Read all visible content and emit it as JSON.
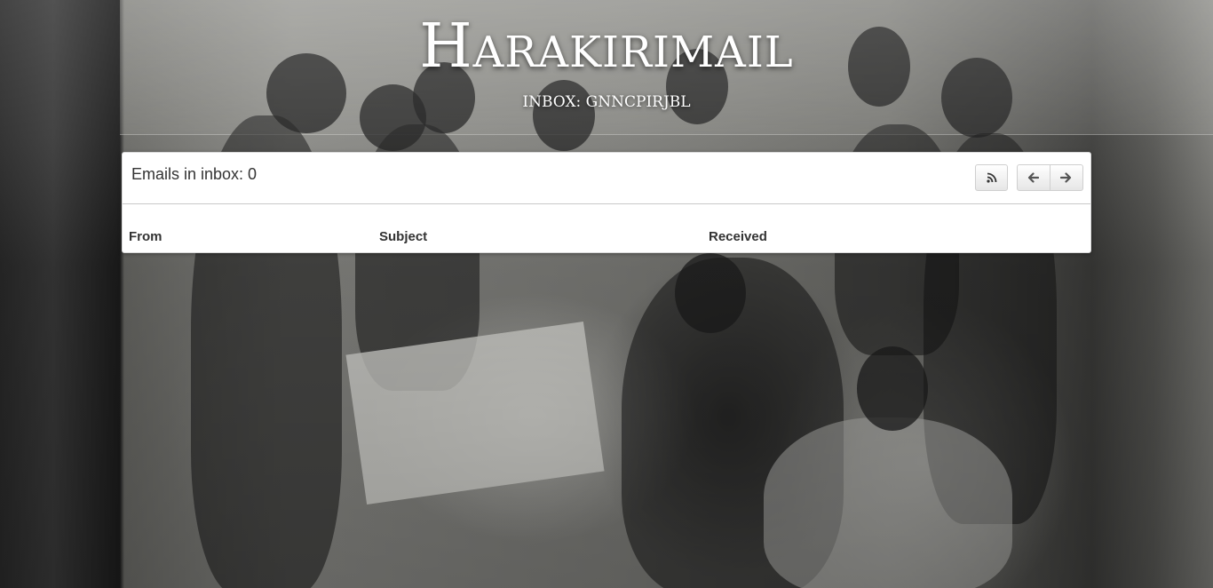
{
  "header": {
    "title": "Harakirimail",
    "inbox_label": "INBOX: GNNCPIRJBL"
  },
  "inbox": {
    "count_text": "Emails in inbox: 0",
    "buttons": {
      "rss_icon": "rss-icon",
      "prev_icon": "arrow-left-icon",
      "next_icon": "arrow-right-icon"
    },
    "columns": [
      "From",
      "Subject",
      "Received"
    ],
    "rows": []
  },
  "colors": {
    "panel_bg": "#ffffff",
    "title_text": "#ffffff",
    "body_text": "#333333"
  }
}
